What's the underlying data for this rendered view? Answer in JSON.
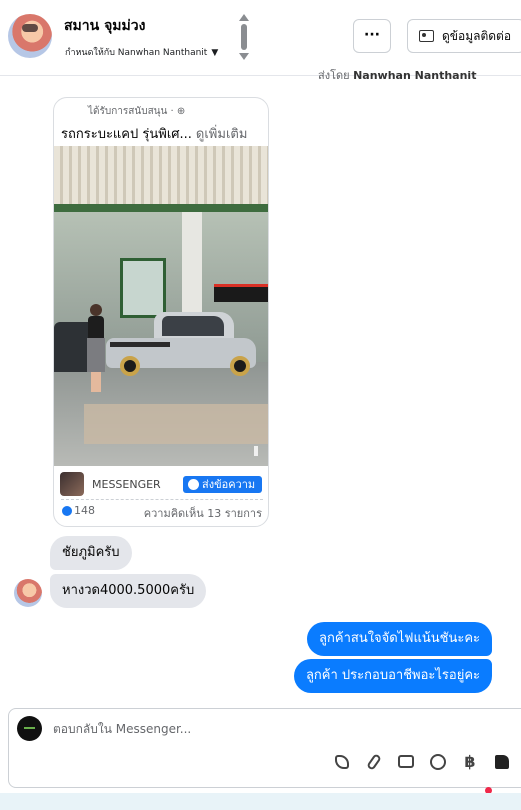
{
  "header": {
    "contact_name": "สมาน จุมม่วง",
    "assigned_label": "กำหนดให้กับ Nanwhan Nanthanit",
    "more_label": "···",
    "view_contact_label": "ดูข้อมูลติดต่อ"
  },
  "sent_by": {
    "prefix": "ส่งโดย",
    "name": "Nanwhan Nanthanit"
  },
  "ad_card": {
    "sponsored_label": "ได้รับการสนับสนุน · ⊕",
    "title": "รถกระบะแคป รุ่นพิเศ...",
    "see_more": "ดูเพิ่มเติม",
    "source_label": "MESSENGER",
    "send_message_label": "ส่งข้อความ",
    "like_count": "148",
    "comments_label": "ความคิดเห็น 13 รายการ"
  },
  "messages": {
    "incoming": [
      "ชัยภูมิครับ",
      "หางวด4000.5000ครับ"
    ],
    "outgoing": [
      "ลูกค้าสนใจจัดไฟแน้นชันะคะ",
      "ลูกค้า ประกอบอาชีพอะไรอยู่คะ"
    ]
  },
  "composer": {
    "placeholder": "ตอบกลับใน Messenger..."
  },
  "colors": {
    "accent": "#0a7cff",
    "brand_blue": "#1877f2"
  }
}
